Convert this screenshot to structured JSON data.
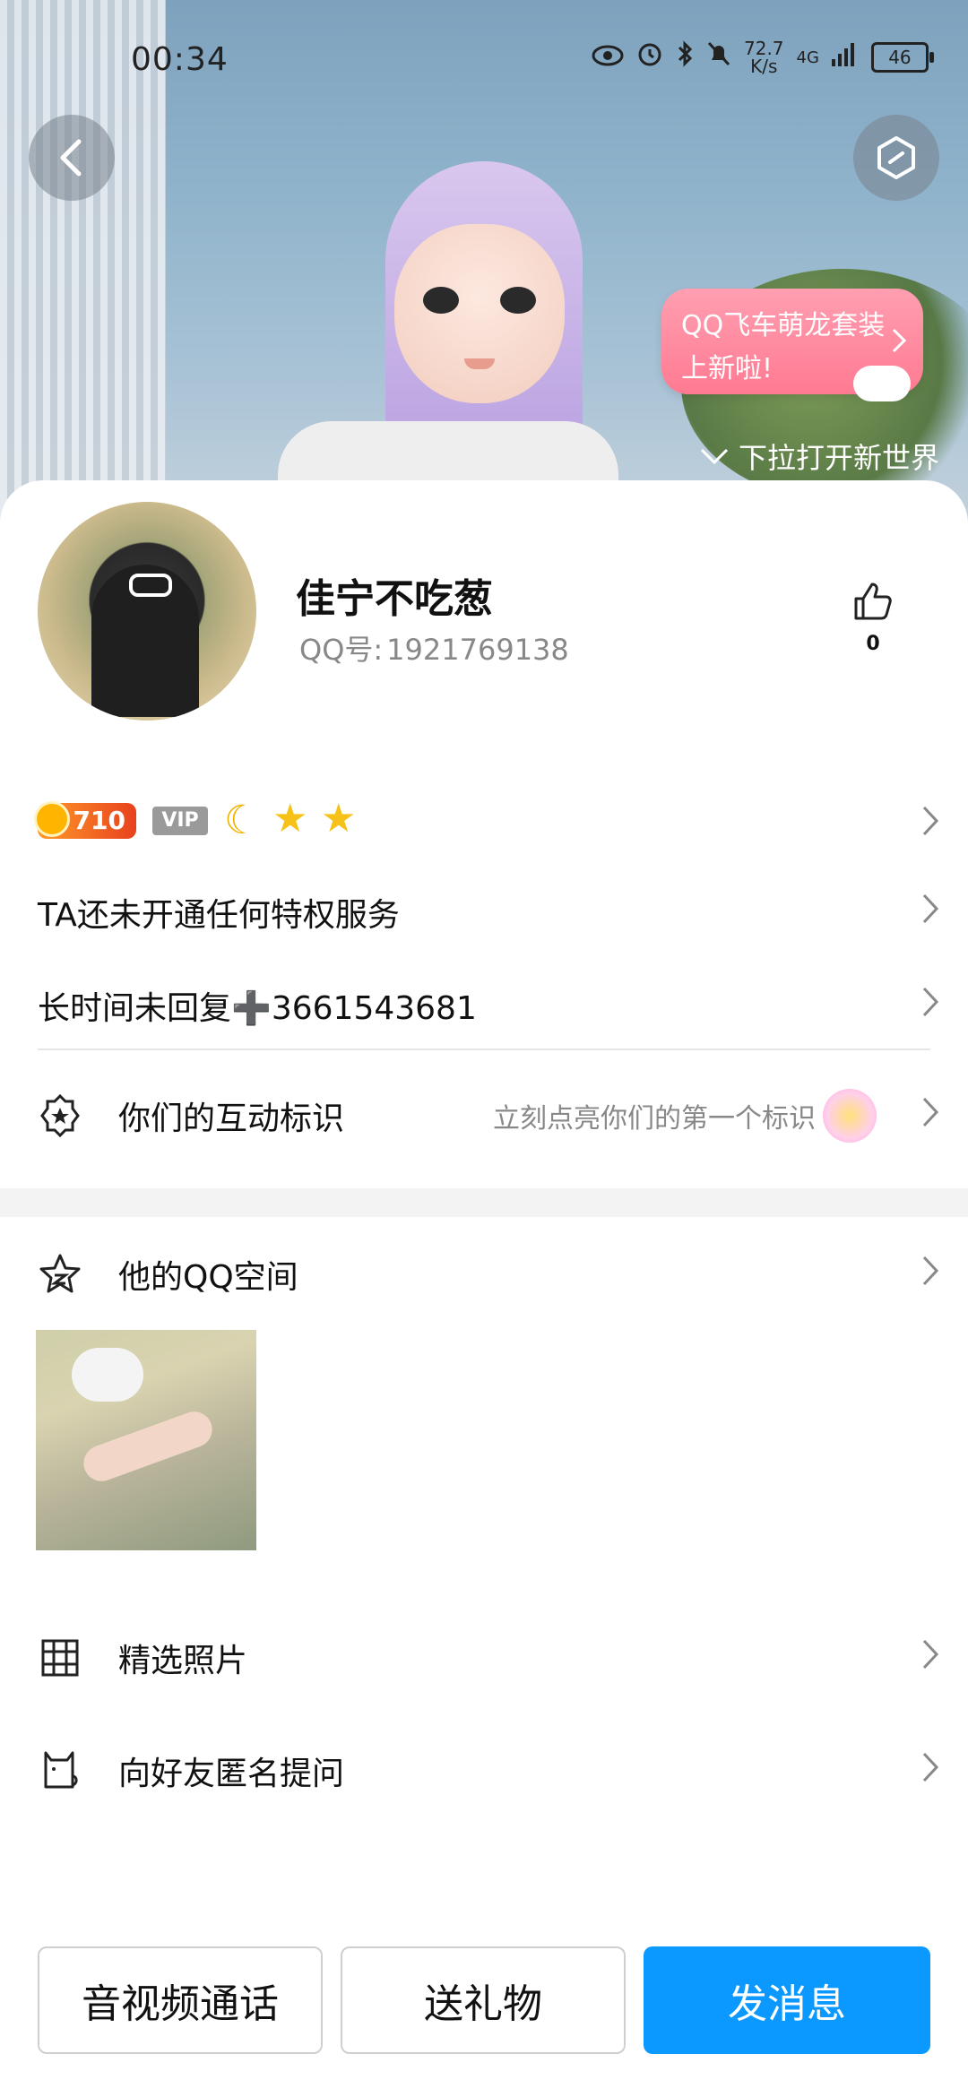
{
  "status_bar": {
    "time": "00:34",
    "speed_top": "72.7",
    "speed_bottom": "K/s",
    "network": "4G",
    "battery": "46"
  },
  "header": {
    "promo_line1": "QQ飞车萌龙套装",
    "promo_line2": "上新啦!",
    "pull_hint": "下拉打开新世界"
  },
  "profile": {
    "name": "佳宁不吃葱",
    "qq_label": "QQ号:",
    "qq_number": "1921769138",
    "likes": "0"
  },
  "badges": {
    "coin_value": "710",
    "vip_label": "VIP"
  },
  "rows": {
    "privilege": "TA还未开通任何特权服务",
    "signature": "长时间未回复➕3661543681",
    "interaction_label": "你们的互动标识",
    "interaction_hint": "立刻点亮你们的第一个标识",
    "qzone_label": "他的QQ空间",
    "featured_photos": "精选照片",
    "anonymous_question": "向好友匿名提问"
  },
  "actions": {
    "call": "音视频通话",
    "gift": "送礼物",
    "message": "发消息"
  },
  "colors": {
    "primary": "#0b99ff",
    "promo": "#ff7a92"
  }
}
